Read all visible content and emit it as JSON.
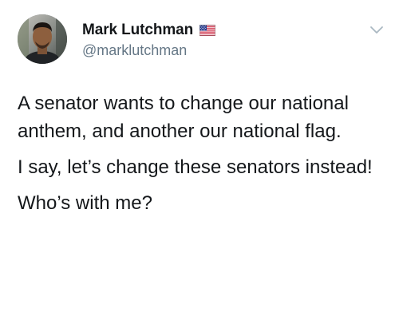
{
  "author": {
    "display_name": "Mark Lutchman",
    "handle": "@marklutchman",
    "avatar_icon": "profile-photo",
    "badge_icon": "us-flag-emoji"
  },
  "menu": {
    "icon": "chevron-down-icon"
  },
  "tweet": {
    "paragraphs": [
      "A senator wants to change our national anthem, and another our national flag.",
      "I say, let’s change these senators instead!",
      "Who’s with me?"
    ]
  },
  "colors": {
    "text": "#14171a",
    "secondary_text": "#657786",
    "background": "#ffffff"
  }
}
